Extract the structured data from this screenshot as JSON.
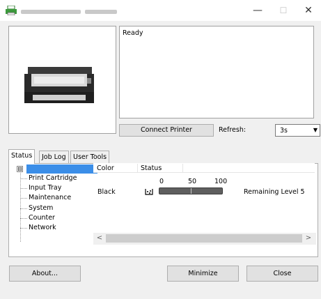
{
  "titlebar": {
    "minimize_glyph": "—",
    "maximize_glyph": "☐",
    "close_glyph": "✕"
  },
  "status_text": "Ready",
  "connect_button": "Connect Printer",
  "refresh": {
    "label": "Refresh:",
    "value": "3s"
  },
  "tabs": [
    {
      "label": "Status",
      "active": true
    },
    {
      "label": "Job Log",
      "active": false
    },
    {
      "label": "User Tools",
      "active": false
    }
  ],
  "tree": {
    "expander": "⊟",
    "items": [
      "Print Cartridge",
      "Input Tray",
      "Maintenance",
      "System",
      "Counter",
      "Network"
    ]
  },
  "list": {
    "columns": [
      "Color",
      "Status"
    ],
    "scale": [
      "0",
      "50",
      "100"
    ],
    "row": {
      "color": "Black",
      "level": 0.5,
      "remaining": "Remaining Level 5"
    }
  },
  "scroll": {
    "left": "<",
    "right": ">"
  },
  "buttons": {
    "about": "About...",
    "minimize": "Minimize",
    "close": "Close"
  },
  "colors": {
    "selection": "#3b8ee8",
    "bar": "#5f5f5f"
  }
}
